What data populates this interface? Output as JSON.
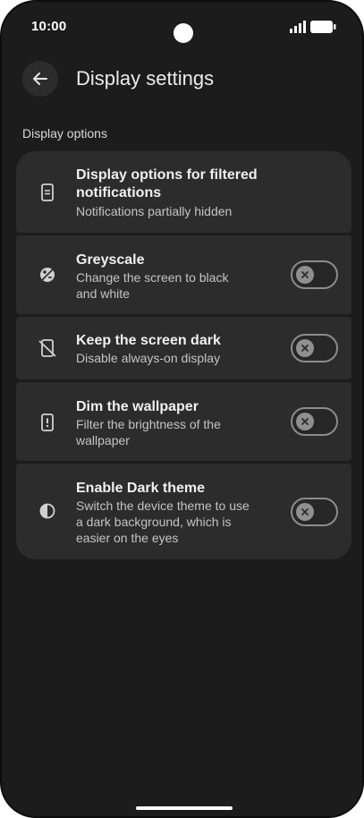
{
  "status_bar": {
    "time": "10:00"
  },
  "header": {
    "title": "Display settings"
  },
  "section": {
    "title": "Display options"
  },
  "settings": [
    {
      "title_line1": "Display options for filtered",
      "title_line2": "notifications",
      "subtitle_line1": "Notifications partially hidden",
      "icon": "phone-notification-icon"
    },
    {
      "title": "Greyscale",
      "subtitle_line1": "Change the screen to black",
      "subtitle_line2": "and white",
      "toggle_on": false,
      "icon": "greyscale-icon"
    },
    {
      "title": "Keep the screen dark",
      "subtitle_line1": "Disable always-on display",
      "toggle_on": false,
      "icon": "screen-off-icon"
    },
    {
      "title": "Dim the wallpaper",
      "subtitle_line1": "Filter the brightness of the",
      "subtitle_line2": "wallpaper",
      "toggle_on": false,
      "icon": "phone-alert-icon"
    },
    {
      "title": "Enable Dark theme",
      "subtitle_line1": "Switch the device theme to use",
      "subtitle_line2": "a dark background, which is",
      "subtitle_line3": "easier on the eyes",
      "toggle_on": false,
      "icon": "contrast-icon"
    }
  ],
  "colors": {
    "background": "#1b1c1b",
    "card": "#2b2c2b",
    "text_primary": "#f0f0f0",
    "text_secondary": "#c4c4c4"
  }
}
